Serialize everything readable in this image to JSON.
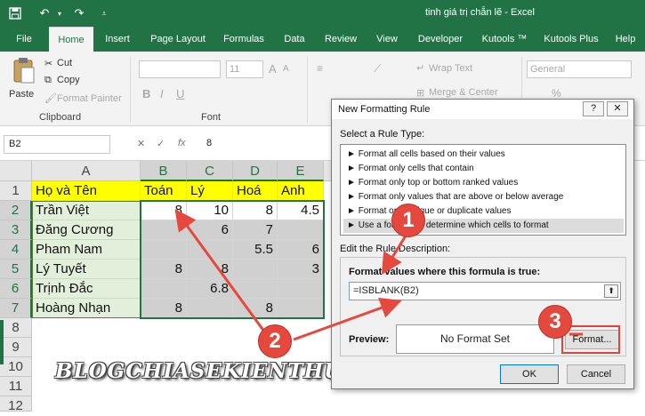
{
  "window": {
    "title": "tinh giá trị chẵn lẽ - Excel"
  },
  "quick_access": {
    "save_icon": "save-icon",
    "undo_icon": "undo-icon",
    "redo_icon": "redo-icon",
    "customize_icon": "customize-icon"
  },
  "tabs": [
    "File",
    "Home",
    "Insert",
    "Page Layout",
    "Formulas",
    "Data",
    "Review",
    "View",
    "Developer",
    "Kutools ™",
    "Kutools Plus",
    "Help"
  ],
  "ribbon": {
    "paste": "Paste",
    "cut": "Cut",
    "copy": "Copy",
    "format_painter": "Format Painter",
    "clipboard_group": "Clipboard",
    "font_group": "Font",
    "font_size": "11",
    "wrap_text": "Wrap Text",
    "merge_center": "Merge & Center",
    "number_format": "General",
    "percent": "%"
  },
  "formula_bar": {
    "name_box": "B2",
    "fx": "fx",
    "value": "8"
  },
  "grid": {
    "columns": [
      "A",
      "B",
      "C",
      "D",
      "E"
    ],
    "rows": [
      "1",
      "2",
      "3",
      "4",
      "5",
      "6",
      "7",
      "8",
      "9",
      "10",
      "11",
      "12"
    ],
    "header_row": [
      "Họ và Tên",
      "Toán",
      "Lý",
      "Hoá",
      "Anh"
    ],
    "data": [
      [
        "Trần Việt",
        "8",
        "10",
        "8",
        "4.5"
      ],
      [
        "Đăng Cương",
        "",
        "6",
        "7",
        ""
      ],
      [
        "Pham Nam",
        "",
        "",
        "5.5",
        "6"
      ],
      [
        "Lý Tuyết",
        "8",
        "8",
        "",
        "3"
      ],
      [
        "Trịnh Đắc",
        "",
        "6.8",
        "",
        ""
      ],
      [
        "Hoàng Nhạn",
        "8",
        "",
        "8",
        ""
      ]
    ]
  },
  "watermark": "BLOGCHIASEKIENTHUC.COM",
  "dialog": {
    "title": "New Formatting Rule",
    "help": "?",
    "close": "✕",
    "select_rule_label": "Select a Rule Type:",
    "rule_types": [
      "Format all cells based on their values",
      "Format only cells that contain",
      "Format only top or bottom ranked values",
      "Format only values that are above or below average",
      "Format only unique or duplicate values",
      "Use a formula to determine which cells to format"
    ],
    "edit_label": "Edit the Rule Description:",
    "formula_label": "Format values where this formula is true:",
    "formula": "=ISBLANK(B2)",
    "preview_label": "Preview:",
    "preview_text": "No Format Set",
    "format_button": "Format...",
    "ok": "OK",
    "cancel": "Cancel"
  },
  "annotations": [
    "1",
    "2",
    "3"
  ],
  "colors": {
    "excel_green": "#217346",
    "header_fill": "#ffff00",
    "name_fill": "#e2efda",
    "blank_fill": "#d0d0d0",
    "annotation_red": "#e5483c"
  }
}
